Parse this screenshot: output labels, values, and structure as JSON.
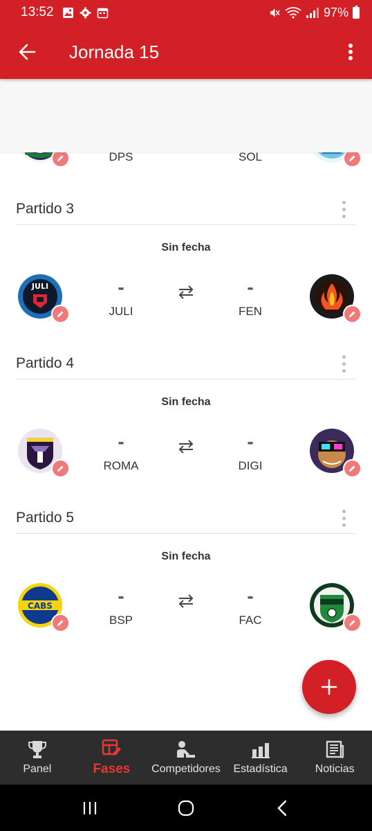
{
  "status": {
    "time": "13:52",
    "battery": "97%"
  },
  "app": {
    "title": "Jornada 15"
  },
  "previous_match": {
    "home_code": "DPS",
    "away_code": "SOL"
  },
  "matches": [
    {
      "title": "Partido 3",
      "date": "Sin fecha",
      "home_score": "-",
      "away_score": "-",
      "home_code": "JULI",
      "away_code": "FEN"
    },
    {
      "title": "Partido 4",
      "date": "Sin fecha",
      "home_score": "-",
      "away_score": "-",
      "home_code": "ROMA",
      "away_code": "DIGI"
    },
    {
      "title": "Partido 5",
      "date": "Sin fecha",
      "home_score": "-",
      "away_score": "-",
      "home_code": "BSP",
      "away_code": "FAC"
    }
  ],
  "nav": [
    {
      "label": "Panel",
      "icon": "trophy-icon"
    },
    {
      "label": "Fases",
      "icon": "bracket-edit-icon",
      "active": true
    },
    {
      "label": "Competidores",
      "icon": "competitors-icon"
    },
    {
      "label": "Estadística",
      "icon": "bar-chart-icon"
    },
    {
      "label": "Noticias",
      "icon": "newspaper-icon"
    }
  ],
  "colors": {
    "primary": "#d32027",
    "edit_badge": "#ef7a7a",
    "nav_bg": "#2d2d2d",
    "nav_active": "#e53935"
  }
}
